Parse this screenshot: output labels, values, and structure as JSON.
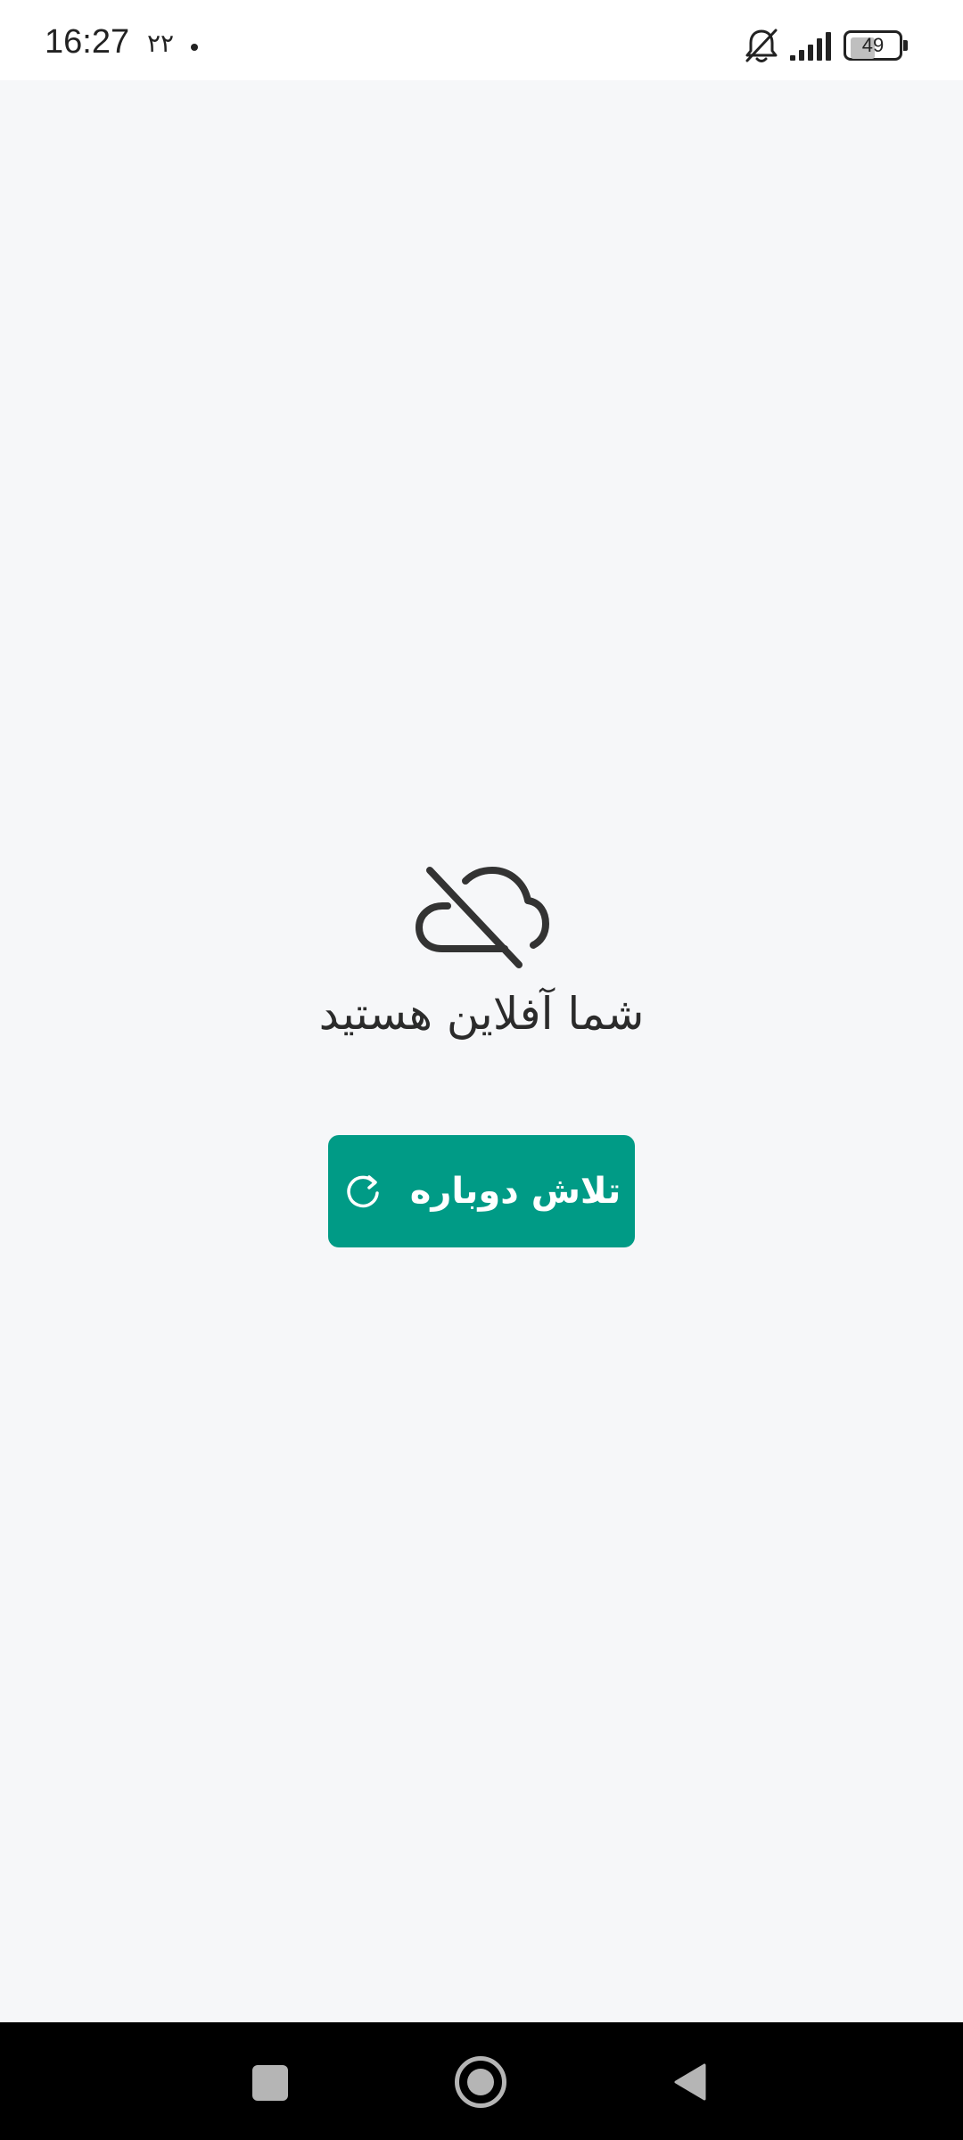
{
  "status_bar": {
    "time": "16:27",
    "extra": "۲۲",
    "battery_level": "49",
    "icons": [
      "mute-icon",
      "signal-icon",
      "battery-icon"
    ]
  },
  "offline": {
    "icon": "cloud-off-icon",
    "message": "شما آفلاین هستید",
    "retry_label": "تلاش دوباره",
    "retry_icon": "refresh-icon"
  },
  "nav_bar": {
    "icons": [
      "recent-apps-icon",
      "home-icon",
      "back-icon"
    ]
  },
  "colors": {
    "accent": "#009b86",
    "background": "#f6f7f9",
    "text": "#2b2b2b"
  }
}
